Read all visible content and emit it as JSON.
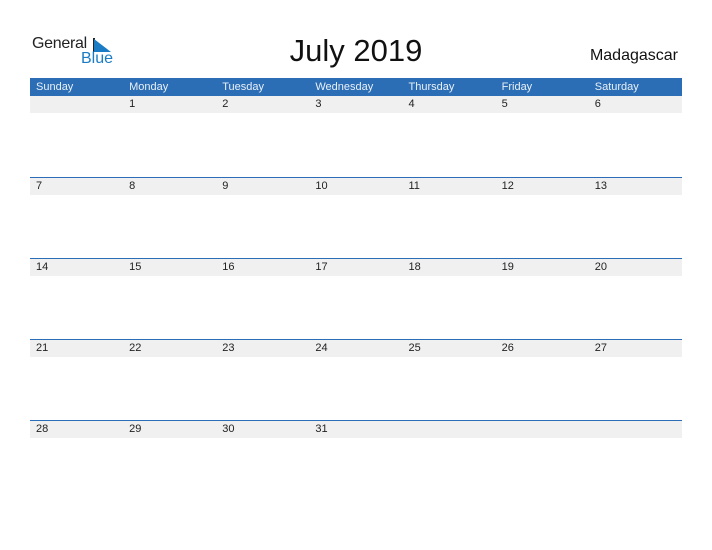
{
  "logo": {
    "word1": "General",
    "word2": "Blue"
  },
  "title": "July 2019",
  "country": "Madagascar",
  "colors": {
    "accent": "#2c6eb5",
    "strip": "#f0f0f0",
    "logo_blue": "#1a7cc4"
  },
  "weekdays": [
    "Sunday",
    "Monday",
    "Tuesday",
    "Wednesday",
    "Thursday",
    "Friday",
    "Saturday"
  ],
  "weeks": [
    [
      "",
      "1",
      "2",
      "3",
      "4",
      "5",
      "6"
    ],
    [
      "7",
      "8",
      "9",
      "10",
      "11",
      "12",
      "13"
    ],
    [
      "14",
      "15",
      "16",
      "17",
      "18",
      "19",
      "20"
    ],
    [
      "21",
      "22",
      "23",
      "24",
      "25",
      "26",
      "27"
    ],
    [
      "28",
      "29",
      "30",
      "31",
      "",
      "",
      ""
    ]
  ]
}
